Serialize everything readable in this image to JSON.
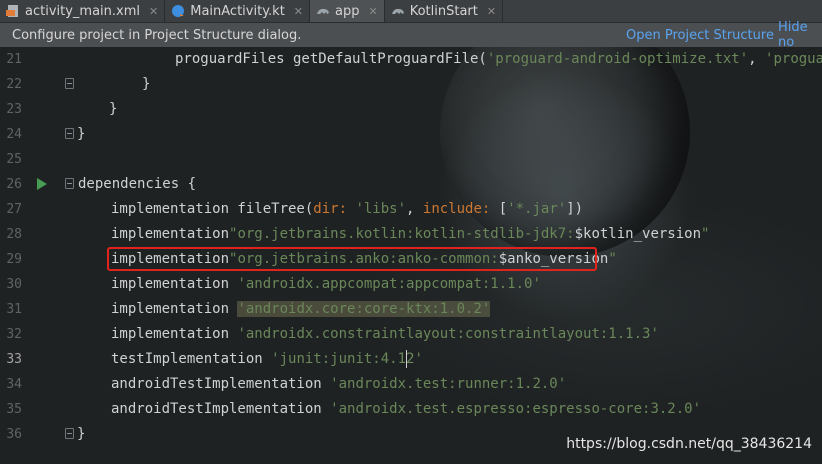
{
  "tabs": [
    {
      "label": "activity_main.xml",
      "icon": "xml-file-icon"
    },
    {
      "label": "MainActivity.kt",
      "icon": "kotlin-class-icon"
    },
    {
      "label": "app",
      "icon": "gradle-icon",
      "active": true
    },
    {
      "label": "KotlinStart",
      "icon": "gradle-icon"
    }
  ],
  "banner": {
    "message": "Configure project in Project Structure dialog.",
    "open_link": "Open Project Structure",
    "hide_link": "Hide no"
  },
  "editor": {
    "current_line": "33",
    "lines": [
      {
        "num": "21",
        "text": "proguardFiles getDefaultProguardFile(",
        "str": "'proguard-android-optimize.txt'",
        "rest": ", ",
        "str2": "'proguard-"
      },
      {
        "num": "22",
        "text": "}"
      },
      {
        "num": "23",
        "text": "}"
      },
      {
        "num": "24",
        "text": ""
      },
      {
        "num": "25",
        "text": ""
      },
      {
        "num": "26",
        "text": "dependencies {"
      },
      {
        "num": "27",
        "pre": "implementation fileTree(",
        "key1": "dir: ",
        "s1": "'libs'",
        "mid": ", ",
        "key2": "include: ",
        "after": "[",
        "s2": "'*.jar'",
        "end": "])"
      },
      {
        "num": "28",
        "pre": "implementation",
        "s1": "\"org.jetbrains.kotlin:kotlin-stdlib-jdk7:",
        "var": "$kotlin_version",
        "s2": "\""
      },
      {
        "num": "29",
        "pre": "implementation",
        "s1": "\"org.jetbrains.anko:anko-common:",
        "var": "$anko_version",
        "s2": "\""
      },
      {
        "num": "30",
        "pre": "implementation ",
        "s1": "'androidx.appcompat:appcompat:1.1.0'"
      },
      {
        "num": "31",
        "pre": "implementation ",
        "s1": "'androidx.core:core-ktx:1.0.2'"
      },
      {
        "num": "32",
        "pre": "implementation ",
        "s1": "'androidx.constraintlayout:constraintlayout:1.1.3'"
      },
      {
        "num": "33",
        "pre": "testImplementation ",
        "s1": "'junit:junit:4.12'"
      },
      {
        "num": "34",
        "pre": "androidTestImplementation ",
        "s1": "'androidx.test:runner:1.2.0'"
      },
      {
        "num": "35",
        "pre": "androidTestImplementation ",
        "s1": "'androidx.test.espresso:espresso-core:3.2.0'"
      },
      {
        "num": "36",
        "text": "}"
      }
    ]
  },
  "watermark": "https://blog.csdn.net/qq_38436214",
  "colors": {
    "string": "#6a8759",
    "keyword": "#cc7832",
    "highlight_box": "#e0231c",
    "link": "#5aa3f0",
    "run_icon": "#499c54"
  }
}
